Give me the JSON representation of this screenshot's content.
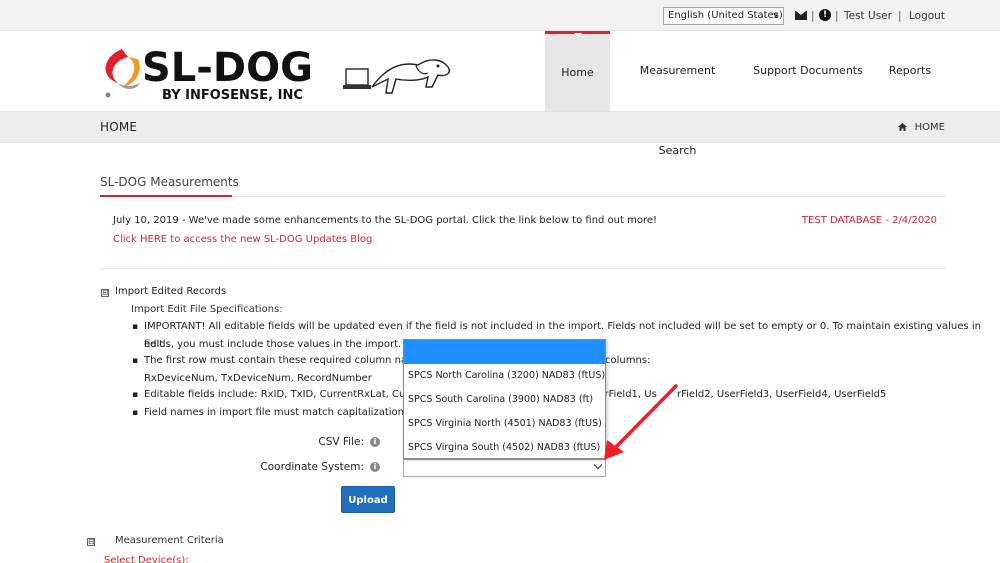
{
  "topbar": {
    "language": "English (United States)",
    "user": "Test User",
    "logout": "Logout",
    "separator": "|"
  },
  "header": {
    "logo_text": "SL-DOG",
    "logo_sub": "BY INFOSENSE, INC",
    "nav": [
      "Home",
      "Measurement Search",
      "Support Documents",
      "Reports"
    ]
  },
  "breadcrumb": {
    "title": "HOME",
    "trail": "HOME"
  },
  "page": {
    "section_title": "SL-DOG Measurements",
    "notice": "July 10, 2019 - We've made some enhancements to the SL-DOG portal. Click the link below to find out more!",
    "notice_link": "Click HERE to access the new SL-DOG Updates Blog",
    "test_db": "TEST DATABASE - 2/4/2020"
  },
  "import": {
    "toggle": "⊟",
    "title": "Import Edited Records",
    "spec_title": "Import Edit File Specifications:",
    "b1_line1": "IMPORTANT! All editable fields will be updated even if the field is not included in the import. Fields not included will be set to empty or 0. To maintain existing values in edit",
    "b1_line2": "fields, you must include those values in the import.",
    "b2_left": "The first row must contain these required column names",
    "b2_right": "columns:",
    "b2_line2": "RxDeviceNum, TxDeviceNum, RecordNumber",
    "b3_left": "Editable fields include: RxID, TxID, CurrentRxLat, CurrentR",
    "b3_right_a": "serField1, Us",
    "b3_right_b": "rField2, UserField3, UserField4, UserField5",
    "b4_left": "Field names in import file must match capitalization of the",
    "csv_label": "CSV File:",
    "coord_label": "Coordinate System:",
    "info": "i",
    "upload": "Upload",
    "dropdown_options": [
      "",
      "SPCS North Carolina (3200) NAD83 (ftUS)",
      "SPCS South Carolina (3900) NAD83 (ft)",
      "SPCS Virginia North (4501) NAD83 (ftUS)",
      "SPCS Virgina South (4502) NAD83 (ftUS)"
    ]
  },
  "measurement": {
    "toggle": "⊟",
    "title": "Measurement Criteria",
    "select_devices": "Select Device(s):"
  },
  "colors": {
    "accent_red": "#e0212b",
    "upload_blue": "#1f6fbf",
    "selected_blue": "#1e90ff"
  }
}
